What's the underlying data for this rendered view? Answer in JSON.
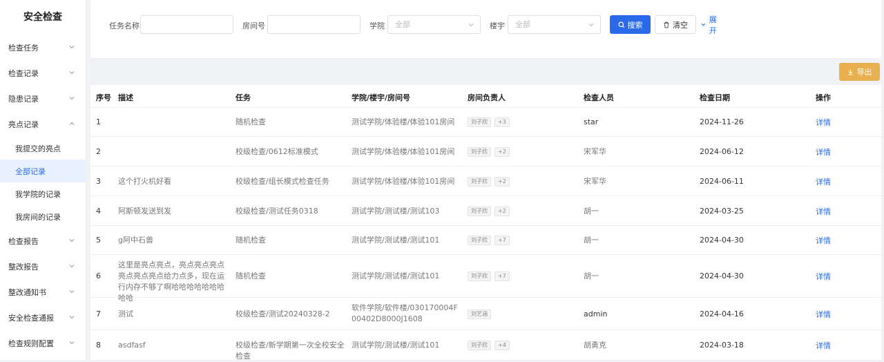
{
  "sidebar": {
    "title": "安全检查",
    "items": [
      {
        "label": "检查任务"
      },
      {
        "label": "检查记录"
      },
      {
        "label": "隐患记录"
      },
      {
        "label": "亮点记录"
      },
      {
        "label": "检查报告"
      },
      {
        "label": "整改报告"
      },
      {
        "label": "整改通知书"
      },
      {
        "label": "安全检查通报"
      },
      {
        "label": "检查规则配置"
      }
    ],
    "subitems": [
      {
        "label": "我提交的亮点"
      },
      {
        "label": "全部记录"
      },
      {
        "label": "我学院的记录"
      },
      {
        "label": "我房间的记录"
      }
    ]
  },
  "filters": {
    "task_label": "任务名称",
    "room_label": "房间号",
    "college_label": "学院",
    "college_value": "全部",
    "building_label": "楼宇",
    "building_value": "全部",
    "search_label": "搜索",
    "clear_label": "清空",
    "expand_label": "展开"
  },
  "export_label": "导出",
  "table": {
    "headers": {
      "seq": "序号",
      "desc": "描述",
      "task": "任务",
      "location": "学院/楼宇/房间号",
      "owner": "房间负责人",
      "inspector": "检查人员",
      "date": "检查日期",
      "action": "操作"
    },
    "rows": [
      {
        "seq": "1",
        "desc": "",
        "task": "随机检查",
        "location": "测试学院/体验楼/体验101房间",
        "owner": "刘子欣",
        "more": "+3",
        "inspector": "star",
        "date": "2024-11-26",
        "action": "详情"
      },
      {
        "seq": "2",
        "desc": "",
        "task": "校级检查/0612标准模式",
        "location": "测试学院/体验楼/体验101房间",
        "owner": "刘子欣",
        "more": "+2",
        "inspector": "宋军华",
        "date": "2024-06-12",
        "action": "详情"
      },
      {
        "seq": "3",
        "desc": "这个打火机好看",
        "task": "校级检查/组长模式检查任务",
        "location": "测试学院/体验楼/体验101房间",
        "owner": "刘子欣",
        "more": "+2",
        "inspector": "宋军华",
        "date": "2024-06-11",
        "action": "详情"
      },
      {
        "seq": "4",
        "desc": "阿斯顿发送到发",
        "task": "校级检查/测试任务0318",
        "location": "测试学院/测试楼/测试103",
        "owner": "刘子欣",
        "more": "+2",
        "inspector": "胡一",
        "date": "2024-03-25",
        "action": "详情"
      },
      {
        "seq": "5",
        "desc": "g阿中石兽",
        "task": "随机检查",
        "location": "测试学院/测试楼/测试101",
        "owner": "刘子欣",
        "more": "+7",
        "inspector": "胡一",
        "date": "2024-04-30",
        "action": "详情"
      },
      {
        "seq": "6",
        "desc": "这里是亮点亮点，亮点亮点亮点亮点亮点亮点给力点多，现在运行内存不够了啊哈哈哈哈哈哈哈哈哈",
        "task": "随机检查",
        "location": "测试学院/测试楼/测试101",
        "owner": "刘子欣",
        "more": "+7",
        "inspector": "胡一",
        "date": "2024-04-30",
        "action": "详情"
      },
      {
        "seq": "7",
        "desc": "测试",
        "task": "校级检查/测试20240328-2",
        "location": "软件学院/软件楼/030170004F00402D8000J1608",
        "owner": "刘艺涵",
        "more": "",
        "inspector": "admin",
        "date": "2024-04-16",
        "action": "详情"
      },
      {
        "seq": "8",
        "desc": "asdfasf",
        "task": "校级检查/新学期第一次全校安全检查",
        "location": "测试学院/测试楼/测试101",
        "owner": "刘子欣",
        "more": "+4",
        "inspector": "胡勇克",
        "date": "2024-03-18",
        "action": "详情"
      }
    ]
  },
  "colors": {
    "primary": "#2a6ae8",
    "export": "#e8b04f",
    "active_bg": "#e8f1ff"
  }
}
